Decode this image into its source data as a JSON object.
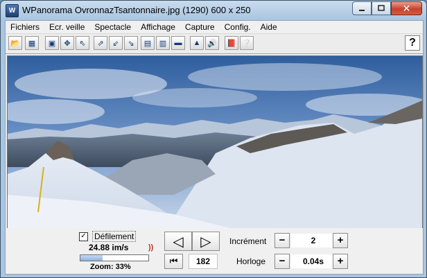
{
  "window": {
    "title": "WPanorama  OvronnazTsantonnaire.jpg   (1290) 600 x 250",
    "icon": "wpanorama-app-icon",
    "controls": [
      "minimize",
      "maximize",
      "close"
    ]
  },
  "menu": [
    "Fichiers",
    "Ecr. veille",
    "Spectacle",
    "Affichage",
    "Capture",
    "Config.",
    "Aide"
  ],
  "toolbar": {
    "buttons": [
      {
        "icon": "open-file-icon",
        "glyph": "📂"
      },
      {
        "icon": "picture-icon",
        "glyph": "▦"
      },
      {
        "icon": "fit-window-icon",
        "glyph": "▣"
      },
      {
        "icon": "expand-arrows-icon",
        "glyph": "✥"
      },
      {
        "icon": "arrow-up-left-icon",
        "glyph": "⇖"
      },
      {
        "icon": "arrow-ne-icon",
        "glyph": "⇗"
      },
      {
        "icon": "arrow-sw-icon",
        "glyph": "⇙"
      },
      {
        "icon": "arrow-se-icon",
        "glyph": "⇘"
      },
      {
        "icon": "panorama-view-1-icon",
        "glyph": "▤"
      },
      {
        "icon": "panorama-view-2-icon",
        "glyph": "▥"
      },
      {
        "icon": "panorama-view-3-icon",
        "glyph": "▬"
      },
      {
        "icon": "mountain-icon",
        "glyph": "▲"
      },
      {
        "icon": "speaker-icon",
        "glyph": "🔊"
      },
      {
        "icon": "book-icon",
        "glyph": "📕"
      },
      {
        "icon": "help-query-icon",
        "glyph": "❔"
      }
    ],
    "help_glyph": "?"
  },
  "controls": {
    "defilement_label": "Défilement",
    "defilement_checked": true,
    "checkbox_glyph": "✓",
    "speed": "24.88 im/s",
    "speed_icon_glyph": "))",
    "zoom_label": "Zoom: 33%",
    "zoom_level": 0.33,
    "prev_glyph": "◁",
    "next_glyph": "▷",
    "first_glyph": "⏮",
    "frame": "182",
    "increment_label": "Incrément",
    "increment_value": "2",
    "horloge_label": "Horloge",
    "horloge_value": "0.04s",
    "minus_glyph": "−",
    "plus_glyph": "+"
  },
  "colors": {
    "title_gradient_top": "#c9dcee",
    "title_gradient_bottom": "#a9c5e0",
    "close_button": "#c8432c",
    "sky": "#5d86c4",
    "snow": "#eef2f8"
  }
}
